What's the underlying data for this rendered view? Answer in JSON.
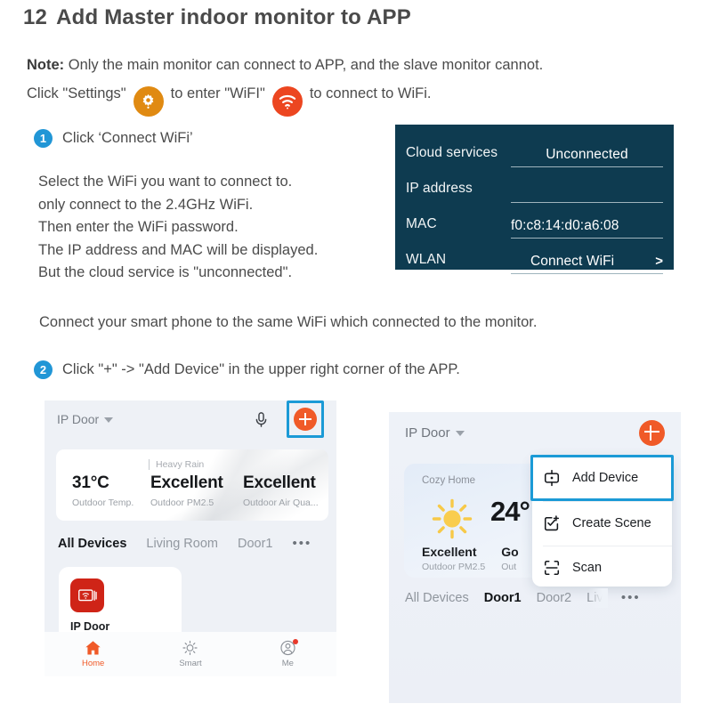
{
  "doc": {
    "section_number": "12",
    "title": "Add Master indoor monitor to APP",
    "note_label": "Note:",
    "note_line1": " Only the main monitor can connect to APP,  and the slave monitor cannot.",
    "note_line2_a": "Click \"Settings\"",
    "note_line2_b": "to enter \"WiFI\"",
    "note_line2_c": "to connect to WiFi.",
    "gear_icon": "gear-icon",
    "wifi_icon": "wifi-icon"
  },
  "steps": {
    "one": {
      "badge": "1",
      "text": "Click ‘Connect WiFi’"
    },
    "one_para": "Select the WiFi you want to connect to.\nonly connect to the 2.4GHz WiFi.\nThen enter the WiFi password.\nThe IP address and MAC will be displayed.\nBut the cloud service is \"unconnected\".",
    "middle_para": "Connect your smart phone to the same WiFi which connected to the monitor.",
    "two": {
      "badge": "2",
      "text": "Click \"+\" -> \"Add Device\" in the upper right corner of the APP."
    }
  },
  "monitor_panel": {
    "background": "#0e3b50",
    "rows": [
      {
        "label": "Cloud services",
        "value": "Unconnected",
        "chevron": ""
      },
      {
        "label": "IP address",
        "value": "",
        "chevron": ""
      },
      {
        "label": "MAC",
        "value": "f0:c8:14:d0:a6:08",
        "chevron": ""
      },
      {
        "label": "WLAN",
        "value": "Connect WiFi",
        "chevron": ">"
      }
    ]
  },
  "phone_left": {
    "home_name": "IP Door",
    "mic_icon": "microphone-icon",
    "add_icon": "plus-icon",
    "weather": {
      "condition": "Heavy Rain",
      "cols": [
        {
          "value": "31°C",
          "caption": "Outdoor Temp."
        },
        {
          "value": "Excellent",
          "caption": "Outdoor PM2.5"
        },
        {
          "value": "Excellent",
          "caption": "Outdoor Air Qua..."
        }
      ]
    },
    "tabs": [
      "All Devices",
      "Living Room",
      "Door1"
    ],
    "tabs_more": "•••",
    "active_tab": "All Devices",
    "device": {
      "name": "IP Door",
      "icon": "door-monitor-icon",
      "icon_color": "#cf2417"
    },
    "bottom_nav": [
      {
        "label": "Home",
        "icon": "home-icon",
        "selected": true
      },
      {
        "label": "Smart",
        "icon": "sun-icon",
        "selected": false
      },
      {
        "label": "Me",
        "icon": "user-icon",
        "selected": false
      }
    ]
  },
  "phone_right": {
    "home_name": "IP Door",
    "add_icon": "plus-icon",
    "weather": {
      "title": "Cozy Home",
      "temp": "24°",
      "sun_icon": "sun-icon",
      "cols": [
        {
          "value": "Excellent",
          "caption": "Outdoor PM2.5"
        },
        {
          "value": "Go",
          "caption": "Out"
        }
      ]
    },
    "menu": [
      {
        "label": "Add Device",
        "icon": "add-device-icon",
        "highlighted": true
      },
      {
        "label": "Create Scene",
        "icon": "create-scene-icon",
        "highlighted": false
      },
      {
        "label": "Scan",
        "icon": "scan-icon",
        "highlighted": false
      }
    ],
    "tabs": [
      "All Devices",
      "Door1",
      "Door2",
      "Livi"
    ],
    "tabs_more": "•••",
    "active_tab": "Door1"
  },
  "colors": {
    "accent_blue": "#1b9ad6",
    "step_blue": "#2196d6",
    "orange": "#f05a28",
    "gear_orange": "#e08a12",
    "wifi_red": "#ec4620",
    "panel_navy": "#0e3b50"
  }
}
